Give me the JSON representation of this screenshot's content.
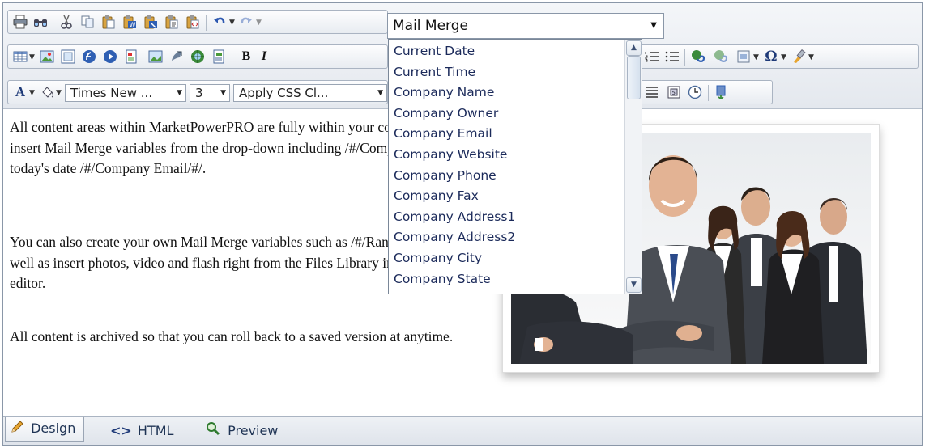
{
  "toolbar": {
    "mail_merge": {
      "selected": "Mail Merge",
      "options": [
        "Current Date",
        "Current Time",
        "Company Name",
        "Company Owner",
        "Company Email",
        "Company Website",
        "Company Phone",
        "Company Fax",
        "Company Address1",
        "Company Address2",
        "Company City",
        "Company State"
      ]
    },
    "font_family": "Times New ...",
    "font_size": "3",
    "css_class": "Apply CSS Cl...",
    "bold_label": "B",
    "italic_label": "I",
    "font_color_label": "A"
  },
  "content": {
    "paragraphs": [
      "All content areas within MarketPowerPRO are fully within your control. You can insert Mail Merge variables from the drop-down including /#/Company Name/#/ or today's date /#/Company Email/#/.",
      "You can also create your own Mail Merge variables such as /#/RankTitleLower/#/ as well as insert photos, video and flash right from the Files Library into the content editor.",
      "All content is archived so that you can roll back to a saved version at anytime."
    ]
  },
  "modes": {
    "design": "Design",
    "html": "HTML",
    "preview": "Preview"
  },
  "icons": [
    "print-icon",
    "find-icon",
    "cut-icon",
    "copy-icon",
    "paste-icon",
    "paste-word-icon",
    "paste-clean-icon",
    "paste-text-icon",
    "paste-html-icon",
    "undo-icon",
    "redo-icon",
    "table-icon",
    "image-manager-icon",
    "image-map-icon",
    "flash-icon",
    "media-icon",
    "document-icon",
    "template-icon",
    "abs-position-icon",
    "link-manager-icon",
    "insert-link-icon",
    "numbered-list-icon",
    "bullet-list-icon",
    "hyperlink-icon",
    "remove-link-icon",
    "form-element-icon",
    "symbol-icon",
    "format-stripper-icon",
    "font-color-icon",
    "highlight-color-icon",
    "paragraph-icon",
    "form-icon",
    "clock-icon",
    "save-icon"
  ]
}
